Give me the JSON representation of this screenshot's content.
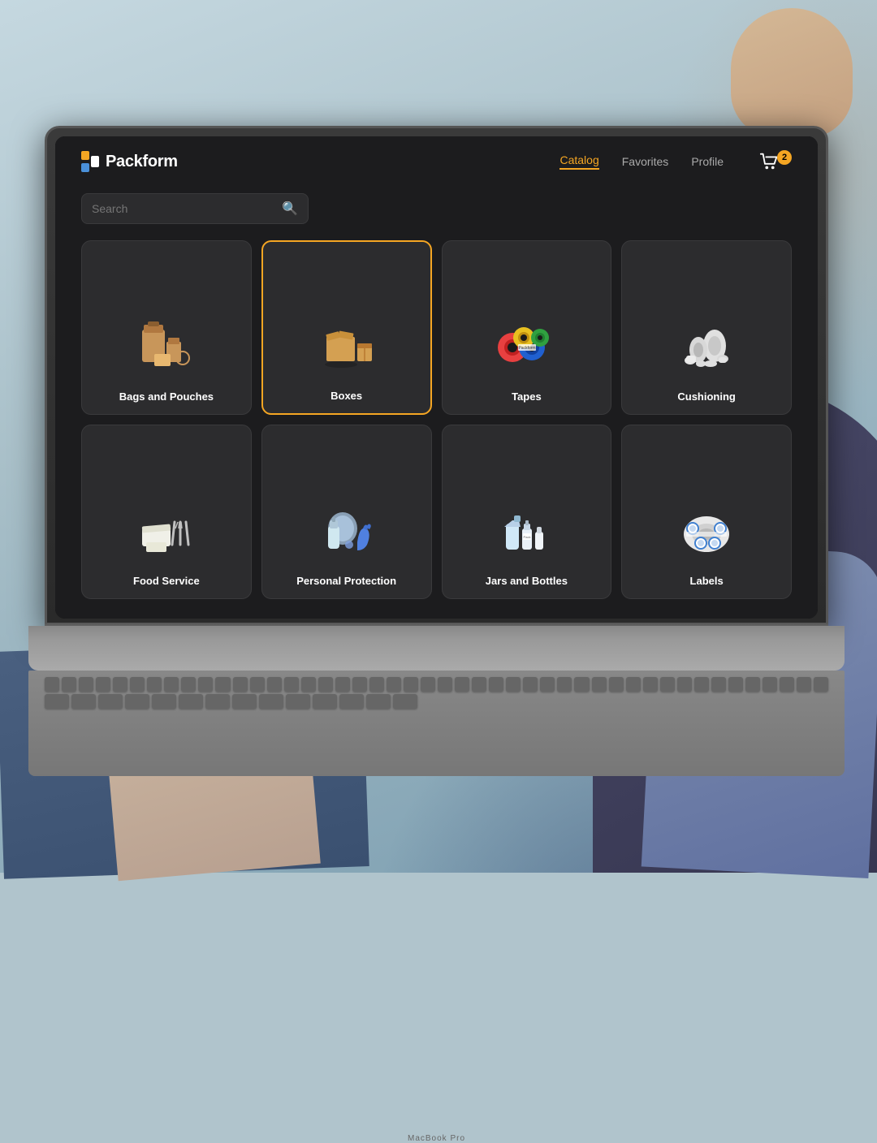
{
  "app": {
    "title": "Packform"
  },
  "nav": {
    "catalog_label": "Catalog",
    "favorites_label": "Favorites",
    "profile_label": "Profile",
    "cart_count": "2"
  },
  "search": {
    "placeholder": "Search",
    "value": ""
  },
  "categories": [
    {
      "id": "bags-pouches",
      "label": "Bags and Pouches",
      "selected": false,
      "emoji": "🛍️"
    },
    {
      "id": "boxes",
      "label": "Boxes",
      "selected": true,
      "emoji": "📦"
    },
    {
      "id": "tapes",
      "label": "Tapes",
      "selected": false,
      "emoji": "🎞️"
    },
    {
      "id": "cushioning",
      "label": "Cushioning",
      "selected": false,
      "emoji": "🧻"
    },
    {
      "id": "food-service",
      "label": "Food Service",
      "selected": false,
      "emoji": "🥡"
    },
    {
      "id": "personal-protection",
      "label": "Personal Protection",
      "selected": false,
      "emoji": "🧤"
    },
    {
      "id": "jars-bottles",
      "label": "Jars and Bottles",
      "selected": false,
      "emoji": "🧴"
    },
    {
      "id": "labels",
      "label": "Labels",
      "selected": false,
      "emoji": "🏷️"
    }
  ],
  "colors": {
    "accent": "#f5a623",
    "bg_dark": "#1c1c1e",
    "card_bg": "#2c2c2e",
    "text_primary": "#ffffff",
    "text_secondary": "#aaaaaa"
  },
  "macbook_label": "MacBook Pro"
}
